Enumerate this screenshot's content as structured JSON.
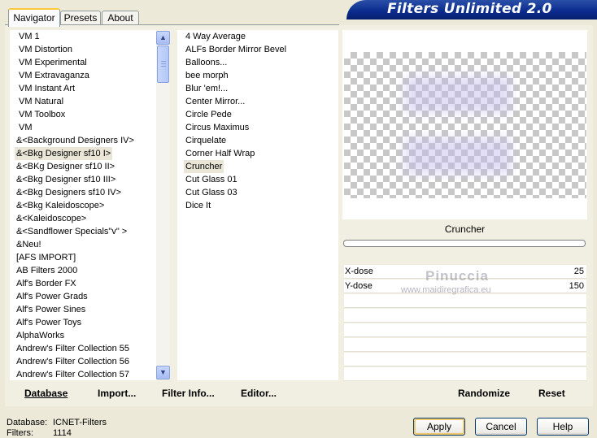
{
  "tabs": [
    "Navigator",
    "Presets",
    "About"
  ],
  "banner_title": "Filters Unlimited 2.0",
  "categories": [
    "VM 1",
    "VM Distortion",
    "VM Experimental",
    "VM Extravaganza",
    "VM Instant Art",
    "VM Natural",
    "VM Toolbox",
    "VM",
    "&<Background Designers IV>",
    "&<Bkg Designer sf10 I>",
    "&<BKg Designer sf10 II>",
    "&<Bkg Designer sf10 III>",
    "&<Bkg Designers sf10 IV>",
    "&<Bkg Kaleidoscope>",
    "&<Kaleidoscope>",
    "&<Sandflower Specials\"v\" >",
    "&Neu!",
    "[AFS IMPORT]",
    "AB Filters 2000",
    "Alf's Border FX",
    "Alf's Power Grads",
    "Alf's Power Sines",
    "Alf's Power Toys",
    "AlphaWorks",
    "Andrew's Filter Collection 55",
    "Andrew's Filter Collection 56",
    "Andrew's Filter Collection 57"
  ],
  "selected_category": "&<Bkg Designer sf10 I>",
  "filters": [
    "4 Way Average",
    "ALFs Border Mirror Bevel",
    "Balloons...",
    "bee morph",
    "Blur 'em!...",
    "Center Mirror...",
    "Circle Pede",
    "Circus Maximus",
    "Cirquelate",
    "Corner Half Wrap",
    "Cruncher",
    "Cut Glass 01",
    "Cut Glass 03",
    "Dice It"
  ],
  "selected_filter": "Cruncher",
  "filter_name": "Cruncher",
  "params": [
    {
      "label": "X-dose",
      "value": "25"
    },
    {
      "label": "Y-dose",
      "value": "150"
    }
  ],
  "watermark": {
    "line1": "Pinuccia",
    "line2": "www.maidiregrafica.eu"
  },
  "list_buttons": [
    "Database",
    "Import...",
    "Filter Info...",
    "Editor..."
  ],
  "preset_buttons": [
    "Randomize",
    "Reset"
  ],
  "dialog_buttons": [
    "Apply",
    "Cancel",
    "Help"
  ],
  "status": {
    "database_label": "Database:",
    "database_value": "ICNET-Filters",
    "filters_label": "Filters:",
    "filters_value": "1114"
  },
  "colors": {
    "window_bg": "#ece9d8",
    "banner": "#0a2a8c",
    "selection": "#e9e6d7"
  }
}
